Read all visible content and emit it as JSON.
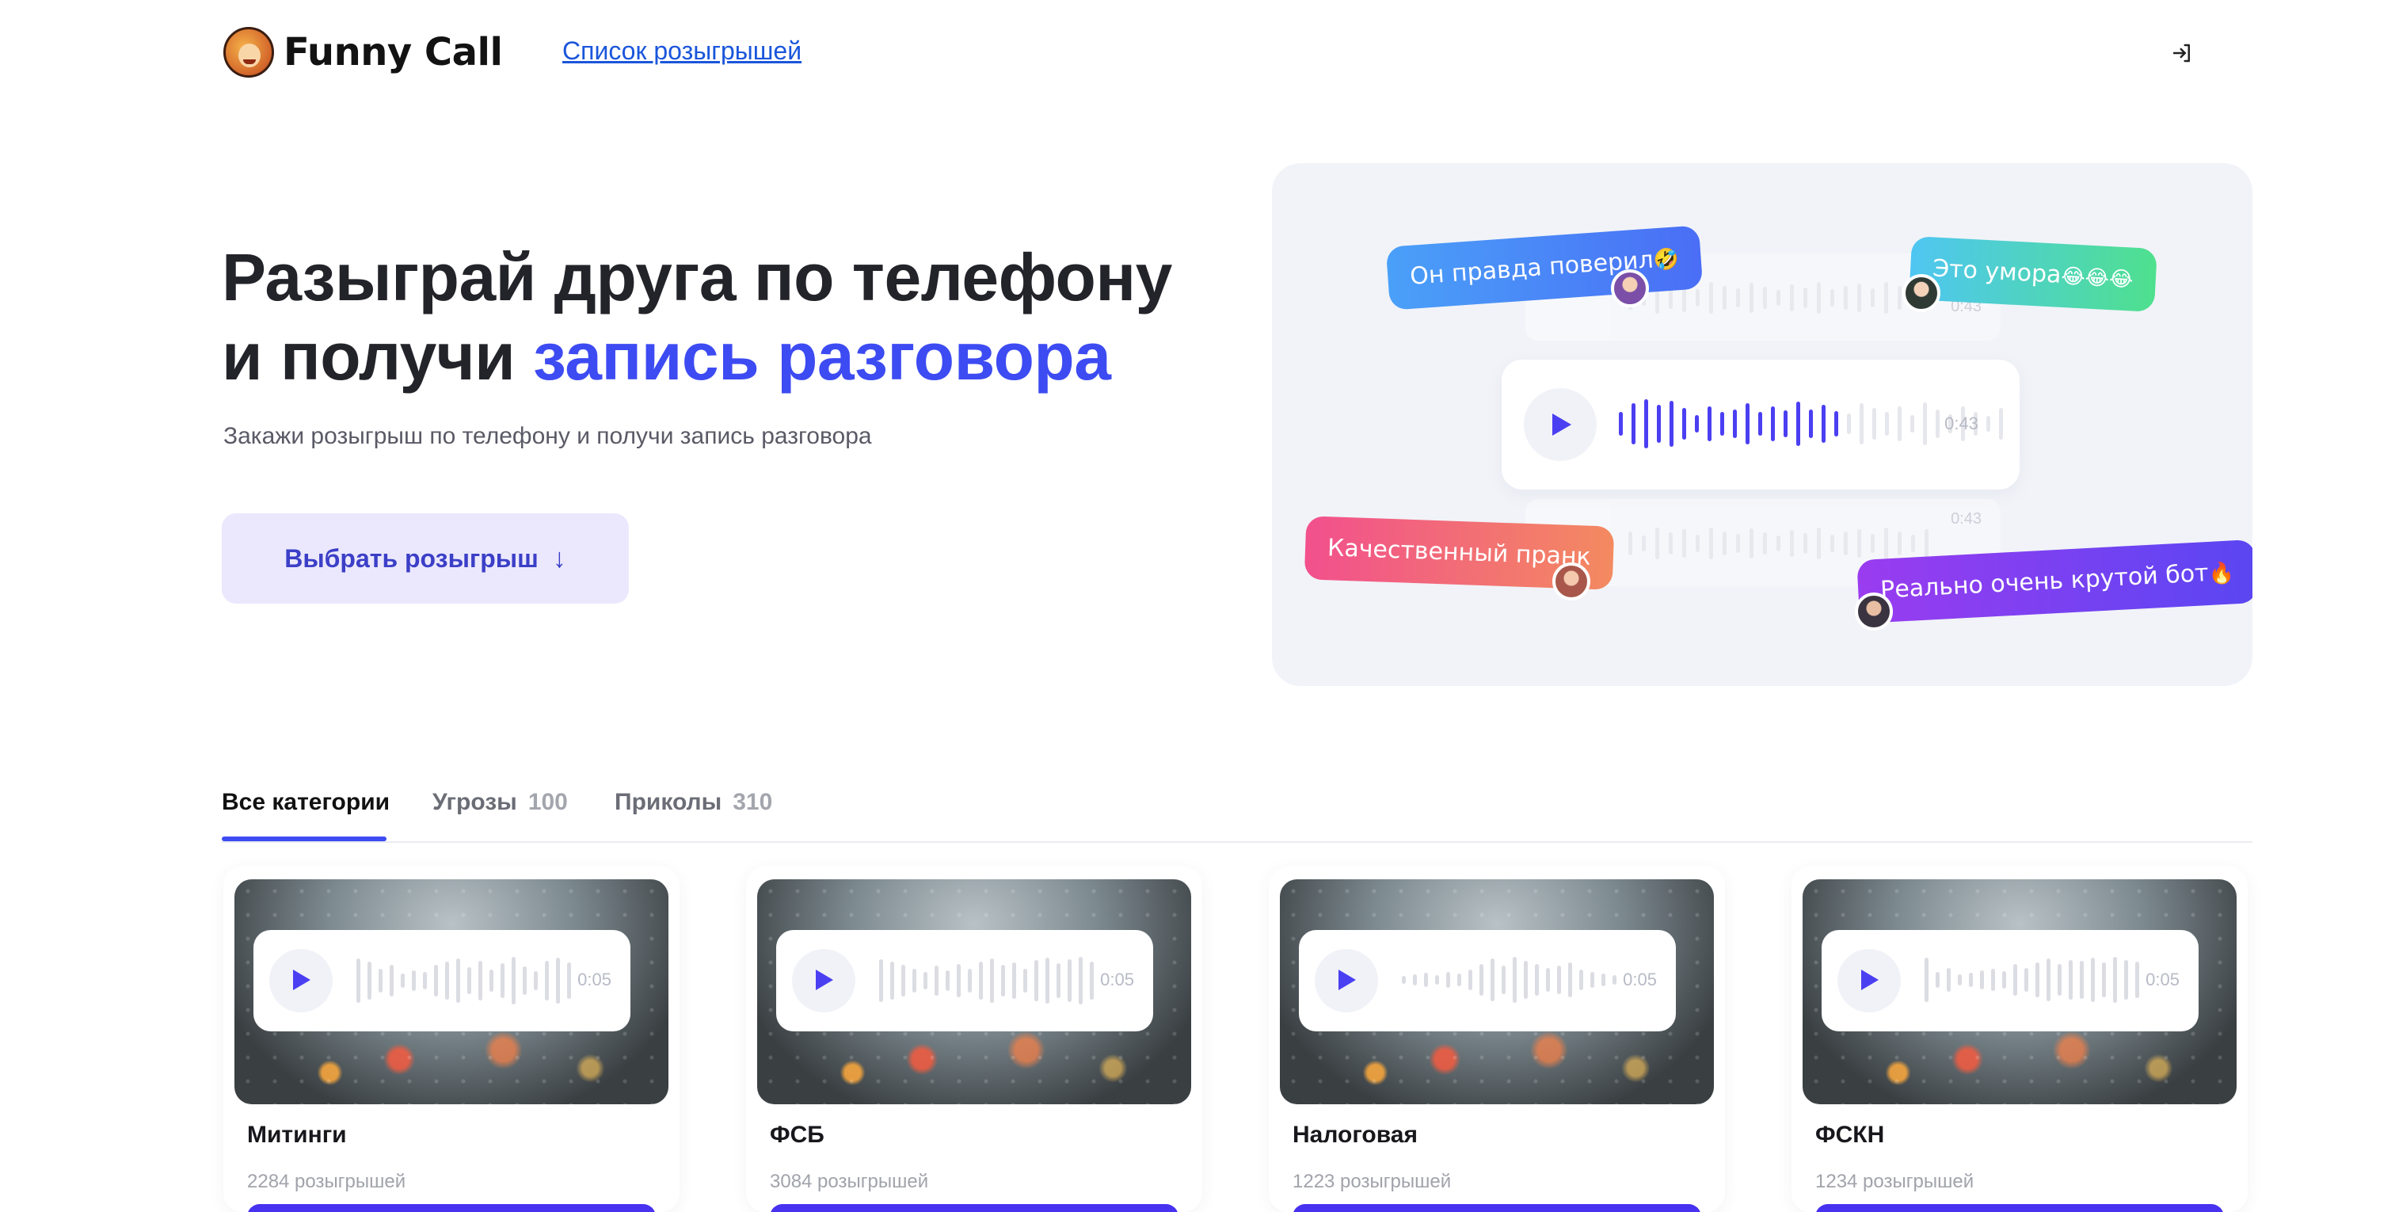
{
  "header": {
    "logo_text": "Funny Call",
    "nav_link": "Список розыгрышей",
    "login_icon": "login-icon"
  },
  "hero": {
    "title_line1": "Разыграй друга по телефону",
    "title_line2_plain": "и получи ",
    "title_line2_accent": "запись разговора",
    "subtitle": "Закажи розыгрыш по телефону и получи запись разговора",
    "button_label": "Выбрать розыгрыш",
    "button_arrow": "↓"
  },
  "illustration": {
    "player_time": "0:43",
    "ghost_time_1": "0:43",
    "ghost_time_2": "0:43",
    "bubbles": [
      {
        "text": "Он правда поверил",
        "emoji": "🤣"
      },
      {
        "text": "Это умора",
        "emoji": "😂😂😂"
      },
      {
        "text": "Качественный пранк",
        "emoji": ""
      },
      {
        "text": "Реально очень крутой бот",
        "emoji": "🔥"
      }
    ],
    "colors": {
      "accent": "#3d4bf2",
      "wave_active": "#4b3ff2",
      "bubble_blue": "#4a8df8",
      "bubble_green": "#4fd49a",
      "bubble_pink": "#f0568c",
      "bubble_purple": "#7a3cf0"
    }
  },
  "tabs": [
    {
      "label": "Все категории",
      "count": ""
    },
    {
      "label": "Угрозы",
      "count": "100"
    },
    {
      "label": "Приколы",
      "count": "310"
    }
  ],
  "cards": [
    {
      "title": "Митинги",
      "count": "2284 розыгрышей",
      "time": "0:05"
    },
    {
      "title": "ФСБ",
      "count": "3084 розыгрышей",
      "time": "0:05"
    },
    {
      "title": "Налоговая",
      "count": "1223 розыгрышей",
      "time": "0:05"
    },
    {
      "title": "ФСКН",
      "count": "1234 розыгрышей",
      "time": "0:05"
    }
  ]
}
